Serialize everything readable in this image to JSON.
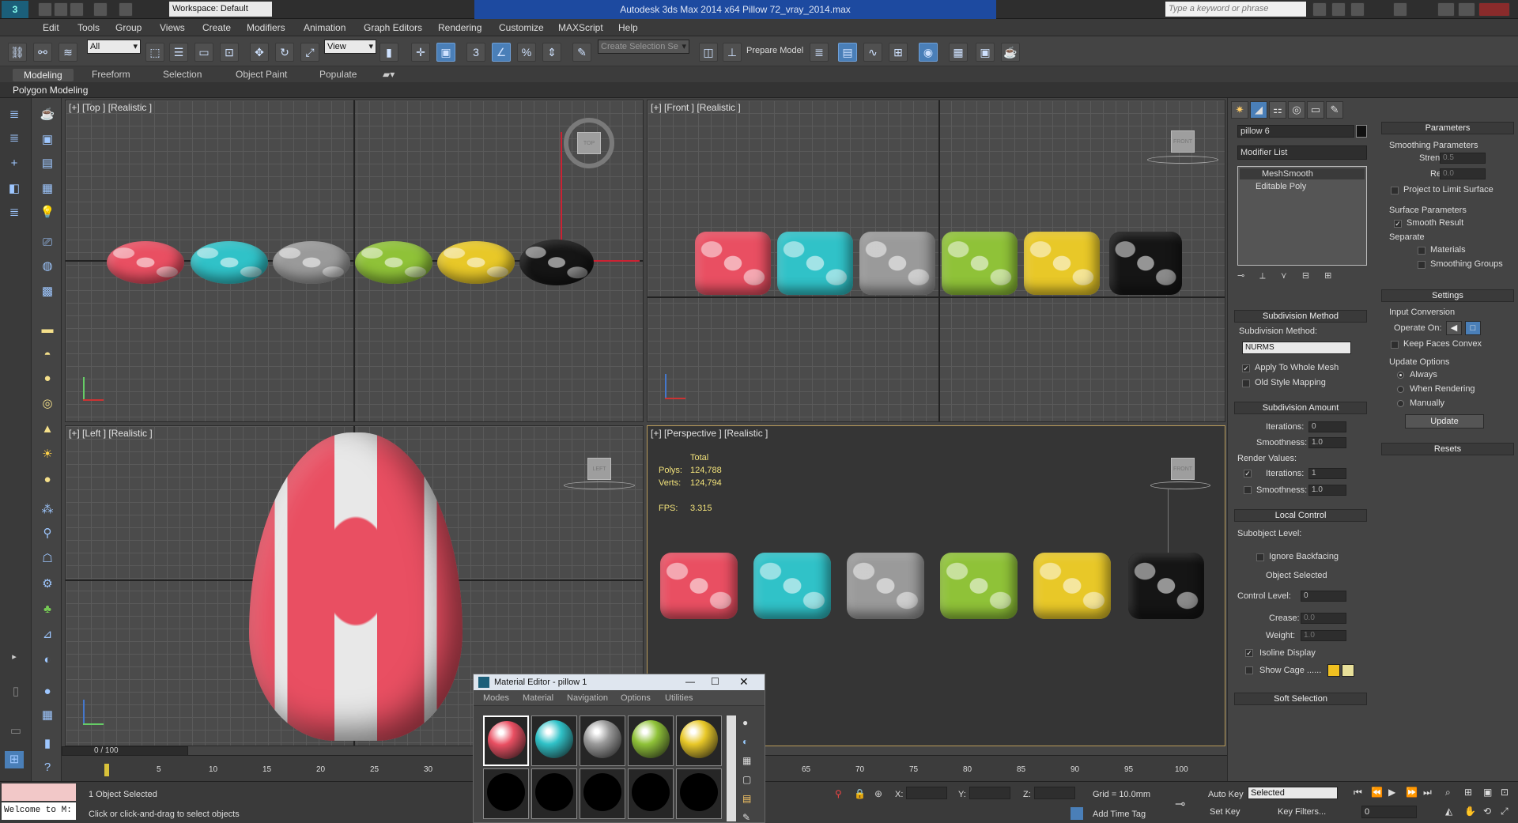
{
  "title_bar": {
    "workspace": "Workspace: Default",
    "app_title": "Autodesk 3ds Max  2014 x64     Pillow 72_vray_2014.max",
    "search_placeholder": "Type a keyword or phrase"
  },
  "menus": [
    "Edit",
    "Tools",
    "Group",
    "Views",
    "Create",
    "Modifiers",
    "Animation",
    "Graph Editors",
    "Rendering",
    "Customize",
    "MAXScript",
    "Help"
  ],
  "toolbar": {
    "filter": "All",
    "ref_coord": "View",
    "named_sel": "Create Selection Se",
    "prepare": "Prepare Model",
    "snap3": "3",
    "pct": "%"
  },
  "ribbon": {
    "tabs": [
      "Modeling",
      "Freeform",
      "Selection",
      "Object Paint",
      "Populate"
    ],
    "sub": "Polygon Modeling"
  },
  "viewports": {
    "top": "[+] [Top ] [Realistic ]",
    "front": "[+] [Front ] [Realistic ]",
    "left": "[+] [Left ] [Realistic ]",
    "persp": "[+] [Perspective ] [Realistic ]"
  },
  "stats": {
    "total": "Total",
    "polys_l": "Polys:",
    "polys": "124,788",
    "verts_l": "Verts:",
    "verts": "124,794",
    "fps_l": "FPS:",
    "fps": "3.315"
  },
  "pillow_colors": [
    "#e94f62",
    "#30c2c8",
    "#9a9a9a",
    "#8fc238",
    "#e8c828",
    "#151515"
  ],
  "command_panel": {
    "object_name": "pillow 6",
    "modifier_list": "Modifier List",
    "stack": [
      "MeshSmooth",
      "Editable Poly"
    ],
    "subdiv_method": {
      "head": "Subdivision Method",
      "label": "Subdivision Method:",
      "value": "NURMS",
      "apply": "Apply To Whole Mesh",
      "old": "Old Style Mapping"
    },
    "subdiv_amount": {
      "head": "Subdivision Amount",
      "iter_l": "Iterations:",
      "iter": "0",
      "smooth_l": "Smoothness:",
      "smooth": "1.0",
      "render": "Render Values:",
      "r_iter": "1",
      "r_smooth": "1.0"
    },
    "local": {
      "head": "Local Control",
      "sub": "Subobject Level:",
      "ignore": "Ignore Backfacing",
      "sel": "Object Selected",
      "cl": "Control Level:",
      "clv": "0",
      "crease": "Crease:",
      "creasev": "0.0",
      "weight": "Weight:",
      "weightv": "1.0",
      "iso": "Isoline Display",
      "cage": "Show Cage ......"
    },
    "soft": "Soft Selection",
    "params": {
      "head": "Parameters",
      "smooth_params": "Smoothing Parameters",
      "strength": "Strength:",
      "strength_v": "0.5",
      "relax": "Relax:",
      "relax_v": "0.0",
      "project": "Project to Limit Surface",
      "surf": "Surface Parameters",
      "smooth_res": "Smooth Result",
      "sep": "Separate",
      "mats": "Materials",
      "sg": "Smoothing Groups"
    },
    "settings": {
      "head": "Settings",
      "input": "Input Conversion",
      "operate": "Operate On:",
      "keep": "Keep Faces Convex",
      "update_opts": "Update Options",
      "always": "Always",
      "when": "When Rendering",
      "manual": "Manually",
      "update": "Update"
    },
    "resets": "Resets"
  },
  "timeline": {
    "frame": "0 / 100",
    "ticks": [
      "5",
      "10",
      "15",
      "20",
      "25",
      "30",
      "65",
      "70",
      "75",
      "80",
      "85",
      "90",
      "95",
      "100"
    ]
  },
  "status": {
    "selected": "1 Object Selected",
    "hint": "Click or click-and-drag to select objects",
    "welcome": "Welcome to M:",
    "x": "X:",
    "y": "Y:",
    "z": "Z:",
    "grid": "Grid = 10.0mm",
    "add_time": "Add Time Tag",
    "auto_key": "Auto Key",
    "set_key": "Set Key",
    "key_filters": "Key Filters...",
    "sel_mode": "Selected",
    "frame": "0"
  },
  "material_editor": {
    "title": "Material Editor - pillow 1",
    "menus": [
      "Modes",
      "Material",
      "Navigation",
      "Options",
      "Utilities"
    ],
    "spheres": [
      "#e94f62",
      "#30c2c8",
      "#9a9a9a",
      "#8fc238",
      "#e8c828"
    ]
  }
}
